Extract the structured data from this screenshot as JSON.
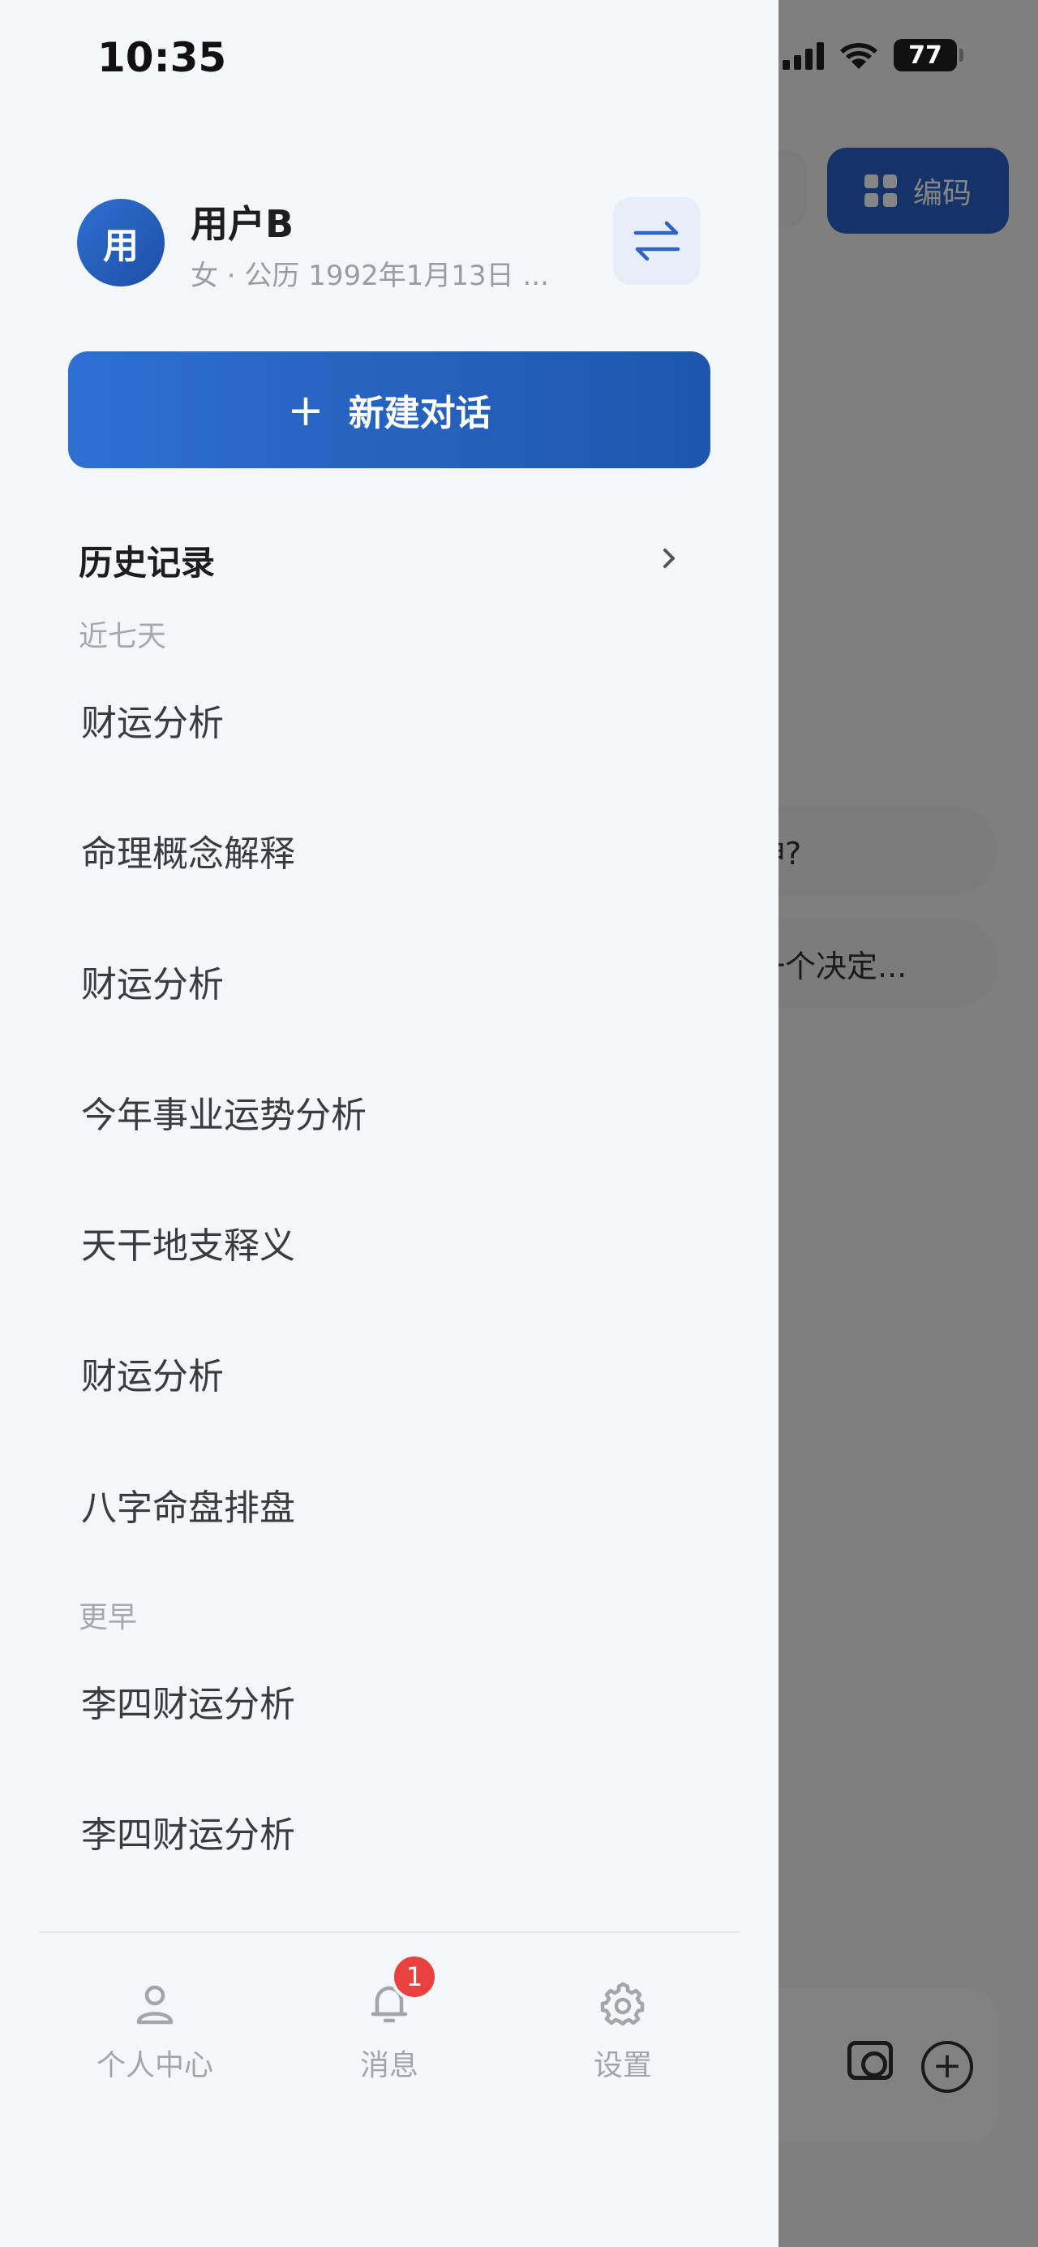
{
  "status_bar": {
    "time": "10:35",
    "battery": "77"
  },
  "background": {
    "code_button_label": "编码",
    "chip_1": "神?",
    "chip_2": "一个决定..."
  },
  "profile": {
    "avatar_text": "用",
    "name": "用户B",
    "subtitle": "女 · 公历 1992年1月13日 ..."
  },
  "new_chat_label": "新建对话",
  "history": {
    "title": "历史记录",
    "sections": [
      {
        "label": "近七天",
        "items": [
          "财运分析",
          "命理概念解释",
          "财运分析",
          "今年事业运势分析",
          "天干地支释义",
          "财运分析",
          "八字命盘排盘"
        ]
      },
      {
        "label": "更早",
        "items": [
          "李四财运分析",
          "李四财运分析"
        ]
      }
    ]
  },
  "bottom_nav": {
    "items": [
      {
        "label": "个人中心",
        "icon": "person-icon"
      },
      {
        "label": "消息",
        "icon": "bell-icon",
        "badge": "1"
      },
      {
        "label": "设置",
        "icon": "gear-icon"
      }
    ]
  },
  "colors": {
    "accent": "#2a62c8",
    "badge": "#e94040",
    "drawer_bg": "#f4f6f9"
  }
}
